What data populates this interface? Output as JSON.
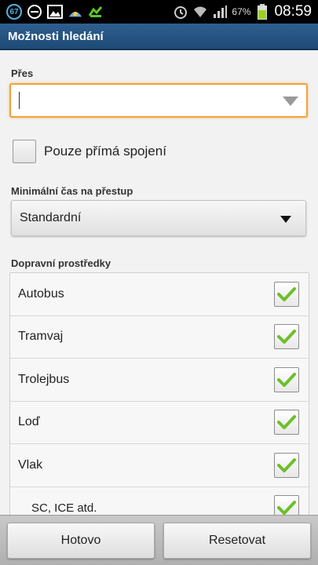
{
  "status_bar": {
    "notification_count": "67",
    "battery_percent": "67%",
    "time": "08:59"
  },
  "action_bar": {
    "title": "Možnosti hledání"
  },
  "via": {
    "label": "Přes",
    "value": ""
  },
  "direct_only": {
    "label": "Pouze přímá spojení",
    "checked": false
  },
  "min_transfer": {
    "label": "Minimální čas na přestup",
    "value": "Standardní"
  },
  "transport": {
    "label": "Dopravní prostředky",
    "items": [
      {
        "label": "Autobus",
        "checked": true
      },
      {
        "label": "Tramvaj",
        "checked": true
      },
      {
        "label": "Trolejbus",
        "checked": true
      },
      {
        "label": "Loď",
        "checked": true
      },
      {
        "label": "Vlak",
        "checked": true
      },
      {
        "label": "SC, ICE atd.",
        "checked": true
      }
    ]
  },
  "buttons": {
    "done": "Hotovo",
    "reset": "Resetovat"
  },
  "colors": {
    "action_bar": "#2a5a88",
    "focus_border": "#f3a13b",
    "check_green": "#6ebf2a",
    "battery": "#9bd11f"
  }
}
